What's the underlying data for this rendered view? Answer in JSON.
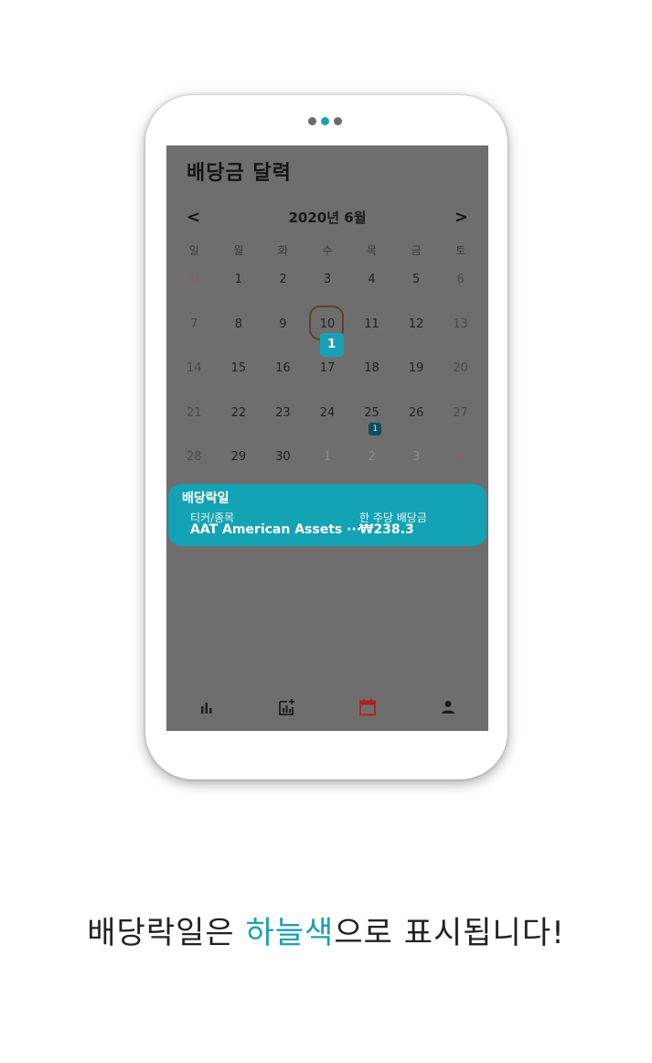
{
  "pager": {
    "count": 3,
    "active_index": 1
  },
  "app": {
    "title": "배당금 달력",
    "month_label": "2020년 6월",
    "prev_icon": "<",
    "next_icon": ">"
  },
  "calendar": {
    "weekdays": [
      "일",
      "월",
      "화",
      "수",
      "목",
      "금",
      "토"
    ],
    "weeks": [
      [
        "31",
        "1",
        "2",
        "3",
        "4",
        "5",
        "6"
      ],
      [
        "7",
        "8",
        "9",
        "10",
        "11",
        "12",
        "13"
      ],
      [
        "14",
        "15",
        "16",
        "17",
        "18",
        "19",
        "20"
      ],
      [
        "21",
        "22",
        "23",
        "24",
        "25",
        "26",
        "27"
      ],
      [
        "28",
        "29",
        "30",
        "1",
        "2",
        "3",
        "4"
      ]
    ],
    "today_label": "10",
    "badge_today": "1",
    "badge_25": "1"
  },
  "popup": {
    "title": "배당락일",
    "ticker_label": "티커/종목",
    "ticker_value": "AAT American Assets ···",
    "amount_label": "한 주당 배당금",
    "amount_value": "₩238.3"
  },
  "tabbar": {
    "items": [
      {
        "icon": "bar-chart-icon",
        "active": false
      },
      {
        "icon": "add-chart-icon",
        "active": false
      },
      {
        "icon": "calendar-icon",
        "active": true
      },
      {
        "icon": "person-icon",
        "active": false
      }
    ]
  },
  "caption": {
    "before": "배당락일은 ",
    "highlight": "하늘색",
    "after": "으로 표시됩니다!"
  },
  "colors": {
    "accent": "#1aa0b4",
    "overlay": "#6e6e6e",
    "active_tab": "#c0392b"
  }
}
